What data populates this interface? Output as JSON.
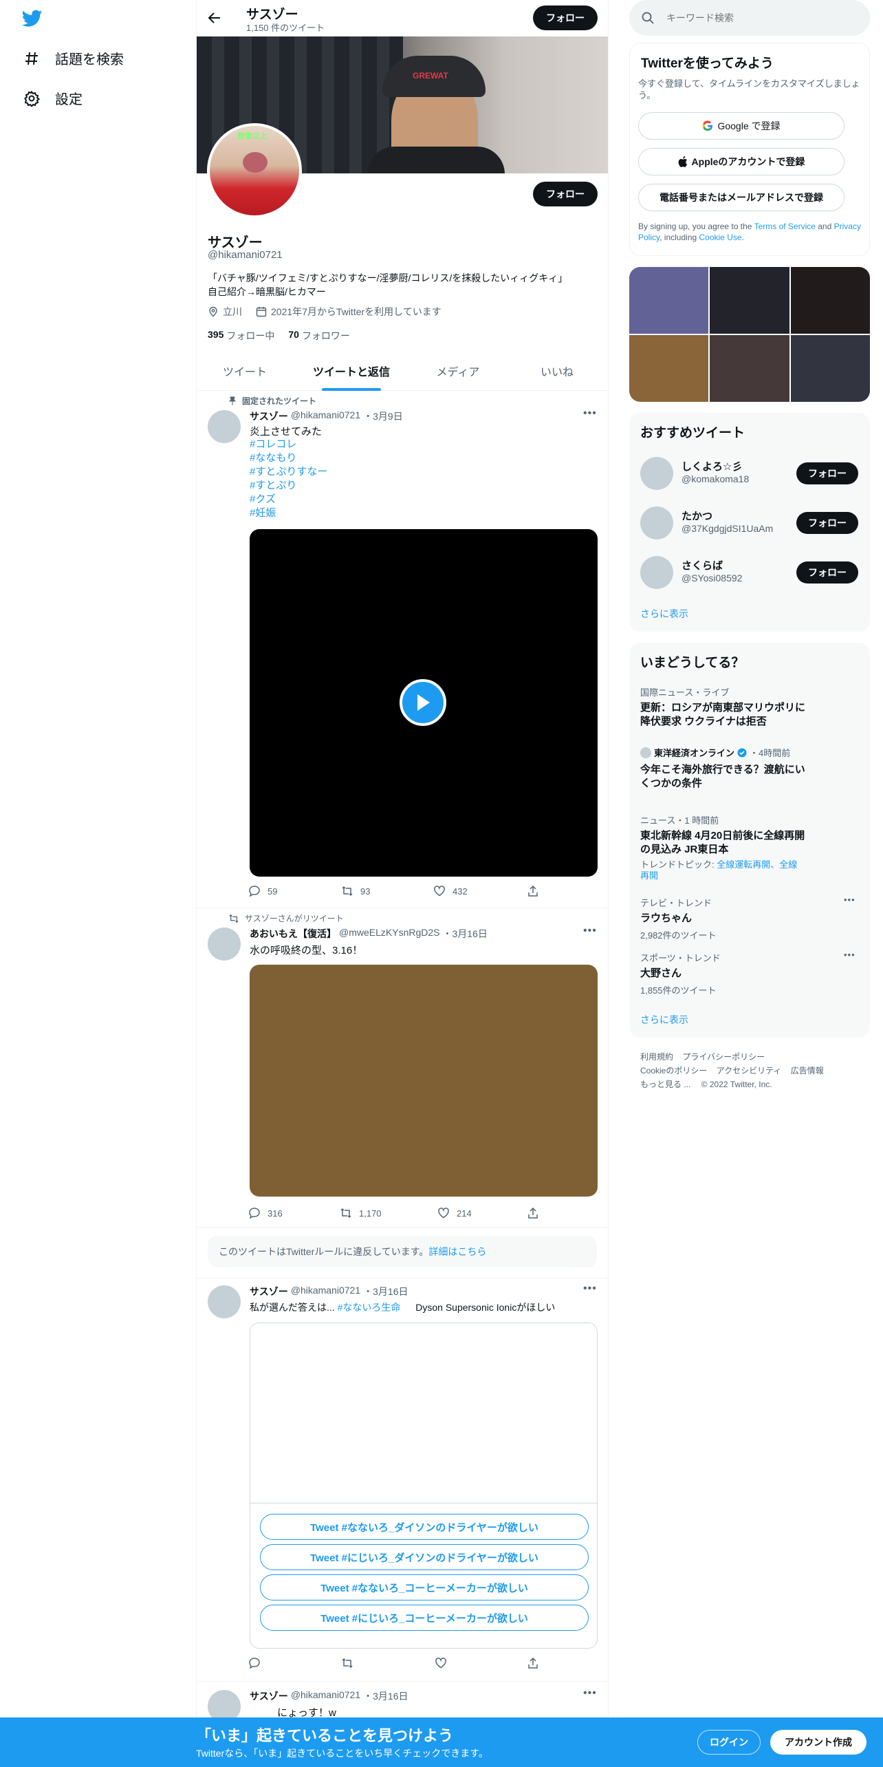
{
  "left_nav": {
    "items": [
      {
        "label": "話題を検索",
        "icon": "hashtag-icon"
      },
      {
        "label": "設定",
        "icon": "gear-icon"
      }
    ]
  },
  "header": {
    "name": "サスゾー",
    "tweet_count": "1,150 件のツイート",
    "follow_label": "フォロー"
  },
  "banner": {
    "cap_text": "GREWAT"
  },
  "avatar_overlay_text": "想像以上",
  "profile": {
    "name": "サスゾー",
    "handle": "@hikamani0721",
    "bio_line1": "「バチャ豚/ツイフェミ/すとぷりすなー/淫夢厨/コレリス/を抹殺したいィィグキィ」",
    "bio_line2": "自己紹介→暗黒脳/ヒカマー",
    "location": "立川",
    "joined": "2021年7月からTwitterを利用しています",
    "following_count": "395",
    "following_label": "フォロー中",
    "followers_count": "70",
    "followers_label": "フォロワー",
    "follow_label": "フォロー"
  },
  "tabs": [
    "ツイート",
    "ツイートと返信",
    "メディア",
    "いいね"
  ],
  "active_tab": 1,
  "tweets": {
    "t1": {
      "pinned_label": "固定されたツイート",
      "name": "サスゾー",
      "handle": "@hikamani0721",
      "date": "・3月9日",
      "text": "炎上させてみた",
      "hashtags": [
        "#コレコレ",
        "#ななもり",
        "#すとぷりすなー",
        "#すとぷり",
        "#クズ",
        "#妊娠"
      ],
      "replies": "59",
      "retweets": "93",
      "likes": "432"
    },
    "t2": {
      "retweet_label": "サスゾーさんがリツイート",
      "name": "あおいもえ【復活】",
      "handle": "@mweELzKYsnRgD2S",
      "date": "・3月16日",
      "text": "水の呼吸終の型、3.16！",
      "replies": "316",
      "retweets": "1,170",
      "likes": "214",
      "media_color": "#7f6035"
    },
    "violation": {
      "text": "このツイートはTwitterルールに違反しています。",
      "link": "詳細はこちら"
    },
    "t3": {
      "name": "サスゾー",
      "handle": "@hikamani0721",
      "date": "・3月16日",
      "text_prefix": "私が選んだ答えは...",
      "hashtag": "#なないろ生命",
      "text_suffix": "Dyson Supersonic Ionicがほしい",
      "poll_options": [
        "Tweet #なないろ_ダイソンのドライヤーが欲しい",
        "Tweet #にじいろ_ダイソンのドライヤーが欲しい",
        "Tweet #なないろ_コーヒーメーカーが欲しい",
        "Tweet #にじいろ_コーヒーメーカーが欲しい"
      ]
    },
    "t4": {
      "name": "サスゾー",
      "handle": "@hikamani0721",
      "date": "・3月16日",
      "text": "にょっす！w"
    }
  },
  "search": {
    "placeholder": "キーワード検索"
  },
  "signup": {
    "title": "Twitterを使ってみよう",
    "subtitle": "今すぐ登録して、タイムラインをカスタマイズしましょう。",
    "google": "Google で登録",
    "apple": "Appleのアカウントで登録",
    "phone": "電話番号またはメールアドレスで登録",
    "terms_1": "By signing up, you agree to the ",
    "terms_tos": "Terms of Service",
    "terms_2": " and ",
    "terms_privacy": "Privacy Policy",
    "terms_3": ", including ",
    "terms_cookie": "Cookie Use",
    "terms_4": "."
  },
  "media_grid": {
    "colors": [
      "#636297",
      "#22232b",
      "#221b1b",
      "#8a6539",
      "#45393a",
      "#323540"
    ]
  },
  "recommended": {
    "title": "おすすめツイート",
    "users": [
      {
        "name": "しくよろ☆彡",
        "handle": "@komakoma18"
      },
      {
        "name": "たかつ",
        "handle": "@37KgdgjdSI1UaAm"
      },
      {
        "name": "さくらば",
        "handle": "@SYosi08592"
      }
    ],
    "follow_label": "フォロー",
    "more": "さらに表示"
  },
  "trends": {
    "title": "いまどうしてる？",
    "items": [
      {
        "meta": "国際ニュース・ライブ",
        "title": "更新：ロシアが南東部マリウポリに降伏要求 ウクライナは拒否"
      },
      {
        "source": "東洋経済オンライン",
        "time": "・4時間前",
        "title": "今年こそ海外旅行できる？渡航にいくつかの条件"
      },
      {
        "meta": "ニュース・1 時間前",
        "title": "東北新幹線 4月20日前後に全線再開の見込み JR東日本",
        "topic_label": "トレンドトピック: ",
        "topic_links": "全線運転再開、全線再開"
      },
      {
        "meta": "テレビ・トレンド",
        "title": "ラウちゃん",
        "count": "2,982件のツイート"
      },
      {
        "meta": "スポーツ・トレンド",
        "title": "大野さん",
        "count": "1,855件のツイート"
      }
    ],
    "more": "さらに表示"
  },
  "footer": {
    "links": [
      "利用規約",
      "プライバシーポリシー",
      "Cookieのポリシー",
      "アクセシビリティ",
      "広告情報",
      "もっと見る ..."
    ],
    "copyright": "© 2022 Twitter, Inc."
  },
  "bottom_bar": {
    "title": "「いま」起きていることを見つけよう",
    "subtitle": "Twitterなら、「いま」起きていることをいち早くチェックできます。",
    "login": "ログイン",
    "signup": "アカウント作成"
  },
  "colors": {
    "brand": "#1d9bf0",
    "dark": "#0f1419",
    "muted": "#536471"
  }
}
